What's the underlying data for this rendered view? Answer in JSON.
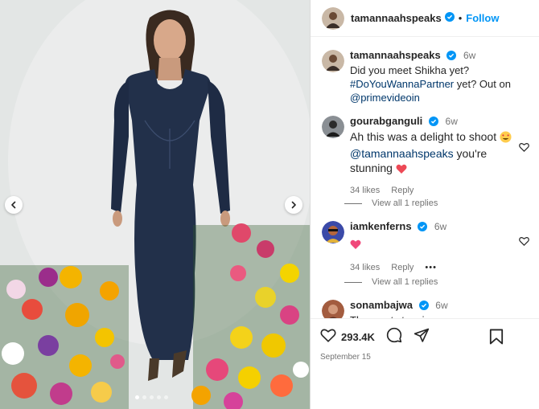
{
  "post": {
    "author": "tamannaahspeaks",
    "follow_label": "Follow",
    "separator": "•",
    "photo": {
      "description_icons": [
        "chevron-left-icon",
        "chevron-right-icon"
      ],
      "carousel_count": 5,
      "active_index": 0
    }
  },
  "comments": [
    {
      "username": "tamannaahspeaks",
      "time": "6w",
      "line1": "Did you meet Shikha yet?",
      "hashtag": "#DoYouWannaPartner",
      "line2_after_hashtag": " yet? Out on",
      "mention": "@primevideoin"
    },
    {
      "username": "gourabganguli",
      "time": "6w",
      "text": "Ah this was a delight to shoot",
      "mention": "@tamannaahspeaks",
      "text_after_mention": " you're",
      "text_line3": "stunning",
      "likes": "34 likes",
      "reply_label": "Reply",
      "view_replies": "View all 1 replies"
    },
    {
      "username": "iamkenferns",
      "time": "6w",
      "likes": "34 likes",
      "reply_label": "Reply",
      "more_label": "•••",
      "view_replies": "View all 1 replies"
    },
    {
      "username": "sonambajwa",
      "time": "6w",
      "text": "The most stunning"
    }
  ],
  "actions": {
    "like_count": "293.4K",
    "date": "September 15",
    "icons": [
      "heart-icon",
      "comment-icon",
      "share-icon",
      "save-icon"
    ]
  },
  "colors": {
    "link": "#00376b",
    "follow": "#0095f6",
    "verified": "#0095f6",
    "heart": "#ed4956"
  }
}
